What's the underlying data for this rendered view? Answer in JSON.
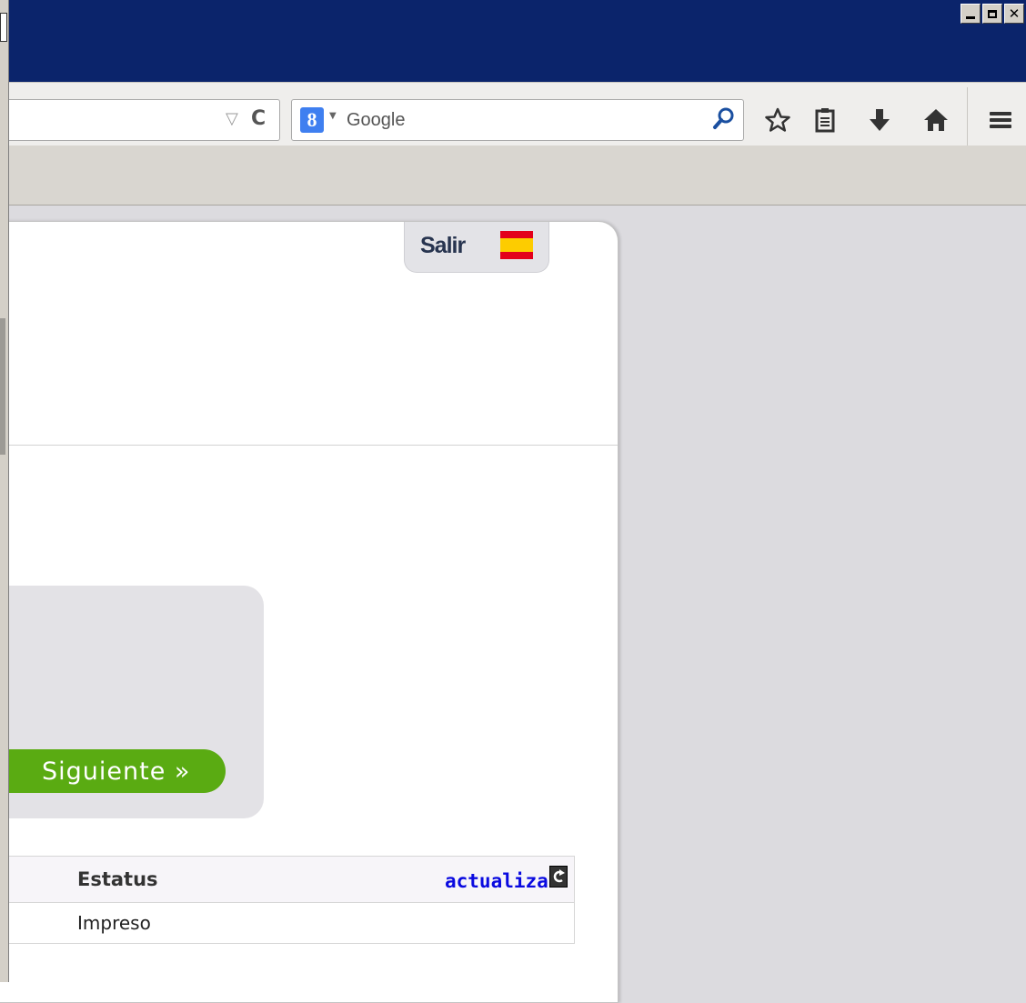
{
  "window": {
    "controls": {
      "minimize": "minimize",
      "maximize": "maximize",
      "close": "✕"
    }
  },
  "toolbar": {
    "search_placeholder": "Google",
    "search_engine_icon": "google-icon",
    "icons": [
      "bookmark-star-icon",
      "reader-list-icon",
      "downloads-arrow-icon",
      "home-icon",
      "menu-hamburger-icon"
    ]
  },
  "header": {
    "logout_label": "Salir",
    "language_flag": "spain-flag-icon"
  },
  "main": {
    "next_button_label": "Siguiente »"
  },
  "table": {
    "columns": {
      "status_header": "Estatus",
      "refresh_label": "actualizar"
    },
    "rows": [
      {
        "status": "Impreso"
      }
    ]
  },
  "colors": {
    "titlebar": "#0b246b",
    "accent_green": "#5aab12",
    "link_blue": "#0a0ae0",
    "flag_red": "#e3001b",
    "flag_yellow": "#fdcc00"
  }
}
